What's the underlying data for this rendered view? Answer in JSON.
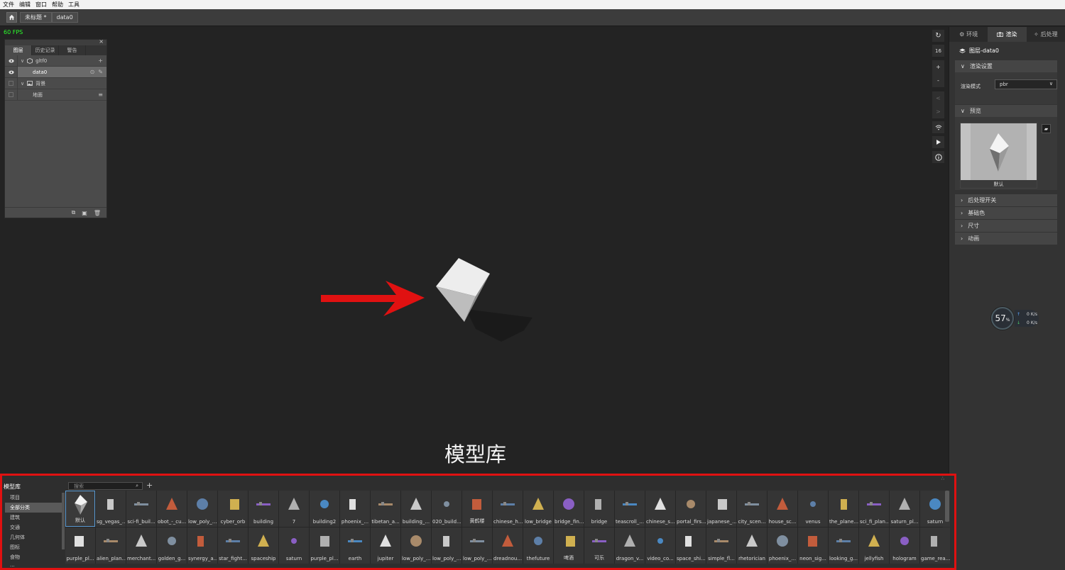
{
  "menubar": {
    "items": [
      "文件",
      "编辑",
      "窗口",
      "帮助",
      "工具"
    ]
  },
  "toolbar": {
    "breadcrumbs": [
      "未标题 *",
      "data0"
    ]
  },
  "viewport": {
    "fps": "60 FPS",
    "caption": "模型库"
  },
  "layers_panel": {
    "tabs": [
      "图层",
      "历史记录",
      "警告"
    ],
    "rows": [
      {
        "label": "gltf0"
      },
      {
        "label": "data0"
      },
      {
        "label": "背景"
      },
      {
        "label": "地面"
      }
    ]
  },
  "toolstrip": {
    "zoom_level": "16",
    "zoom_in": "+",
    "zoom_out": "-",
    "prev": "<",
    "next": ">"
  },
  "right_panel": {
    "tabs": [
      "环境",
      "渲染",
      "后处理"
    ],
    "layer_title": "图层-data0",
    "sections": {
      "render_settings": "渲染设置",
      "preview": "预览",
      "post_switch": "后处理开关",
      "base_color": "基础色",
      "size": "尺寸",
      "animation": "动画"
    },
    "render_mode_label": "渲染模式",
    "render_mode_value": "pbr",
    "preview_label": "默认"
  },
  "perf": {
    "percent": "57",
    "unit": "%",
    "up_rate": "0",
    "down_rate": "0",
    "rate_unit": "K/s"
  },
  "library": {
    "title": "模型库",
    "search_placeholder": "搜索",
    "categories": [
      "项目",
      "全部分类",
      "建筑",
      "交通",
      "几何体",
      "图标",
      "食物",
      "..."
    ],
    "items": [
      "默认",
      "sg_vegas_...",
      "sci-fi_buil...",
      "obot_-_cu...",
      "low_poly_...",
      "cyber_orb",
      "building",
      "7",
      "building2",
      "phoenix_...",
      "tibetan_a...",
      "building_...",
      "020_build...",
      "黄鹤楼",
      "chinese_h...",
      "low_bridge",
      "bridge_fin...",
      "bridge",
      "teascroll_...",
      "chinese_s...",
      "portal_firs...",
      "japanese_...",
      "city_scen...",
      "house_sc...",
      "venus",
      "the_plane...",
      "sci_fi_plan...",
      "saturn_pl...",
      "saturn",
      "purple_pl...",
      "alien_plan...",
      "merchant...",
      "golden_g...",
      "synergy_a...",
      "star_fight...",
      "spaceship",
      "saturn",
      "purple_pl...",
      "earth",
      "jupiter",
      "low_poly_...",
      "low_poly_...",
      "low_poly_...",
      "dreadnou...",
      "thefuture",
      "啤酒",
      "可乐",
      "dragon_v...",
      "video_co...",
      "space_shi...",
      "simple_fl...",
      "rhetorician",
      "phoenix_...",
      "neon_sig...",
      "looking_g...",
      "jellyfish",
      "hologram",
      "game_rea..."
    ]
  },
  "colors": {
    "accent_red": "#e01111",
    "fps_green": "#2cff2c",
    "selection_blue": "#5a9bd4"
  }
}
